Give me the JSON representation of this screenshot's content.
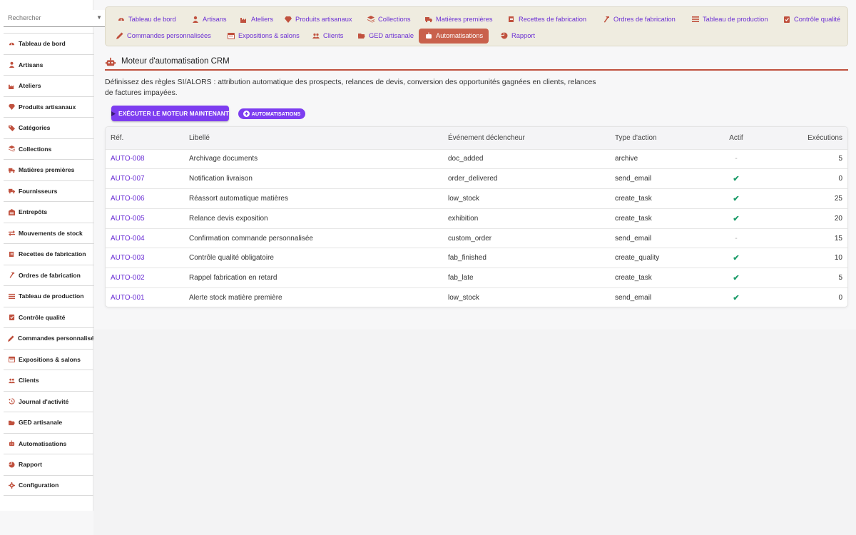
{
  "search": {
    "placeholder": "Rechercher"
  },
  "sidebar": {
    "items": [
      {
        "label": "Tableau de bord",
        "icon": "dashboard-icon"
      },
      {
        "label": "Artisans",
        "icon": "user-icon"
      },
      {
        "label": "Ateliers",
        "icon": "industry-icon"
      },
      {
        "label": "Produits artisanaux",
        "icon": "gem-icon"
      },
      {
        "label": "Catégories",
        "icon": "tags-icon"
      },
      {
        "label": "Collections",
        "icon": "layers-icon"
      },
      {
        "label": "Matières premières",
        "icon": "truck-icon"
      },
      {
        "label": "Fournisseurs",
        "icon": "shipping-icon"
      },
      {
        "label": "Entrepôts",
        "icon": "warehouse-icon"
      },
      {
        "label": "Mouvements de stock",
        "icon": "exchange-icon"
      },
      {
        "label": "Recettes de fabrication",
        "icon": "scroll-icon"
      },
      {
        "label": "Ordres de fabrication",
        "icon": "hammer-icon"
      },
      {
        "label": "Tableau de production",
        "icon": "bars-icon"
      },
      {
        "label": "Contrôle qualité",
        "icon": "clipboard-check-icon"
      },
      {
        "label": "Commandes personnalisées",
        "icon": "pencil-icon"
      },
      {
        "label": "Expositions & salons",
        "icon": "calendar-icon"
      },
      {
        "label": "Clients",
        "icon": "users-icon"
      },
      {
        "label": "Journal d'activité",
        "icon": "history-icon"
      },
      {
        "label": "GED artisanale",
        "icon": "folder-open-icon"
      },
      {
        "label": "Automatisations",
        "icon": "robot-icon"
      },
      {
        "label": "Rapport",
        "icon": "pie-chart-icon"
      },
      {
        "label": "Configuration",
        "icon": "cog-icon"
      }
    ]
  },
  "tabs": [
    {
      "label": "Tableau de bord",
      "icon": "dashboard-icon"
    },
    {
      "label": "Artisans",
      "icon": "user-icon"
    },
    {
      "label": "Ateliers",
      "icon": "industry-icon"
    },
    {
      "label": "Produits artisanaux",
      "icon": "gem-icon"
    },
    {
      "label": "Collections",
      "icon": "layers-icon"
    },
    {
      "label": "Matières premières",
      "icon": "truck-icon"
    },
    {
      "label": "Recettes de fabrication",
      "icon": "scroll-icon"
    },
    {
      "label": "Ordres de fabrication",
      "icon": "hammer-icon"
    },
    {
      "label": "Tableau de production",
      "icon": "bars-icon"
    },
    {
      "label": "Contrôle qualité",
      "icon": "clipboard-check-icon"
    },
    {
      "label": "Commandes personnalisées",
      "icon": "pencil-icon"
    },
    {
      "label": "Expositions & salons",
      "icon": "calendar-icon"
    },
    {
      "label": "Clients",
      "icon": "users-icon"
    },
    {
      "label": "GED artisanale",
      "icon": "folder-open-icon"
    },
    {
      "label": "Automatisations",
      "icon": "robot-icon",
      "active": true
    },
    {
      "label": "Rapport",
      "icon": "pie-chart-icon"
    }
  ],
  "main": {
    "title": "Moteur d'automatisation CRM",
    "title_icon": "robot-icon",
    "description": "Définissez des règles SI/ALORS : attribution automatique des prospects, relances de devis, conversion des opportunités gagnées en clients, relances de factures impayées.",
    "run_button_label": "EXÉCUTER LE MOTEUR MAINTENANT",
    "automations_button_label": "AUTOMATISATIONS"
  },
  "table": {
    "headers": {
      "ref": "Réf.",
      "label": "Libellé",
      "event": "Événement déclencheur",
      "action": "Type d'action",
      "active": "Actif",
      "executions": "Exécutions"
    },
    "rows": [
      {
        "ref": "AUTO-008",
        "label": "Archivage documents",
        "event": "doc_added",
        "action": "archive",
        "active": false,
        "executions": "5"
      },
      {
        "ref": "AUTO-007",
        "label": "Notification livraison",
        "event": "order_delivered",
        "action": "send_email",
        "active": true,
        "executions": "0"
      },
      {
        "ref": "AUTO-006",
        "label": "Réassort automatique matières",
        "event": "low_stock",
        "action": "create_task",
        "active": true,
        "executions": "25"
      },
      {
        "ref": "AUTO-005",
        "label": "Relance devis exposition",
        "event": "exhibition",
        "action": "create_task",
        "active": true,
        "executions": "20"
      },
      {
        "ref": "AUTO-004",
        "label": "Confirmation commande personnalisée",
        "event": "custom_order",
        "action": "send_email",
        "active": false,
        "executions": "15"
      },
      {
        "ref": "AUTO-003",
        "label": "Contrôle qualité obligatoire",
        "event": "fab_finished",
        "action": "create_quality",
        "active": true,
        "executions": "10"
      },
      {
        "ref": "AUTO-002",
        "label": "Rappel fabrication en retard",
        "event": "fab_late",
        "action": "create_task",
        "active": true,
        "executions": "5"
      },
      {
        "ref": "AUTO-001",
        "label": "Alerte stock matière première",
        "event": "low_stock",
        "action": "send_email",
        "active": true,
        "executions": "0"
      }
    ],
    "active_mark": "✔",
    "inactive_mark": "-"
  },
  "colors": {
    "accent_purple": "#7d3df0",
    "link_purple": "#6b2fd4",
    "icon_red": "#c0513e",
    "active_tab": "#c9614c",
    "check_green": "#1f9d6b",
    "tabbar_bg": "#efece0"
  }
}
